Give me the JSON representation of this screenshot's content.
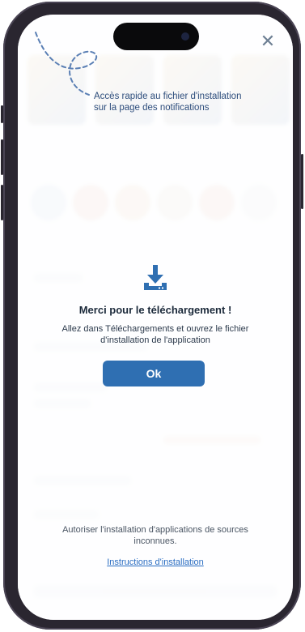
{
  "overlay": {
    "close_glyph": "✕",
    "hint": "Accès rapide au fichier d'installation sur la page des notifications",
    "title": "Merci pour le téléchargement !",
    "message": "Allez dans Téléchargements et ouvrez le fichier d'installation de l'application",
    "ok_label": "Ok",
    "allow_text": "Autoriser l'installation d'applications de sources inconnues.",
    "instructions_link": "Instructions d'installation"
  },
  "icons": {
    "close": "close-icon",
    "download": "download-icon",
    "arrow": "dashed-arrow-icon"
  },
  "colors": {
    "accent": "#2f6fb2",
    "link": "#2a6dc2",
    "phone_frame": "#2a2630"
  }
}
